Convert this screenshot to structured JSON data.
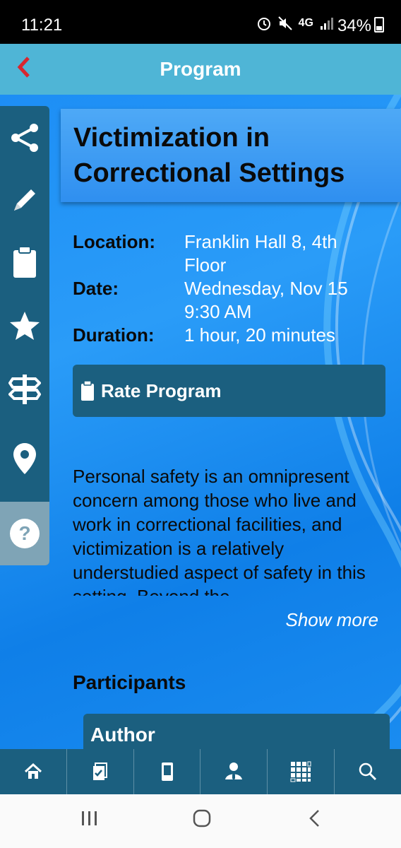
{
  "status_bar": {
    "time": "11:21",
    "network": "4G",
    "battery": "34%"
  },
  "header": {
    "title": "Program",
    "back_icon": "chevron-left-icon"
  },
  "side_menu": {
    "items": [
      {
        "icon": "share-icon"
      },
      {
        "icon": "pencil-icon"
      },
      {
        "icon": "clipboard-icon"
      },
      {
        "icon": "star-icon"
      },
      {
        "icon": "signpost-icon"
      },
      {
        "icon": "map-pin-icon"
      },
      {
        "icon": "help-icon"
      }
    ]
  },
  "program": {
    "title": "Victimization in Correctional Settings",
    "location_label": "Location:",
    "location_value": "Franklin Hall 8, 4th Floor",
    "date_label": "Date:",
    "date_value": "Wednesday, Nov 15",
    "time_value": "9:30 AM",
    "duration_label": "Duration:",
    "duration_value": "1 hour, 20 minutes",
    "rate_button": "Rate Program",
    "description": "Personal safety is an omnipresent concern among those who live and work in correctional facilities, and victimization is a relatively understudied aspect of safety in this setting. Beyond the",
    "show_more": "Show more",
    "participants_heading": "Participants",
    "author_label": "Author"
  },
  "tab_bar": {
    "tabs": [
      {
        "icon": "home-icon"
      },
      {
        "icon": "schedule-icon"
      },
      {
        "icon": "device-icon"
      },
      {
        "icon": "speaker-icon"
      },
      {
        "icon": "grid-icon"
      },
      {
        "icon": "search-icon"
      }
    ]
  },
  "colors": {
    "header": "#4fb5d6",
    "panel": "#1b5f7f",
    "background": "#1a8cf0",
    "back_arrow": "#d8262f"
  }
}
